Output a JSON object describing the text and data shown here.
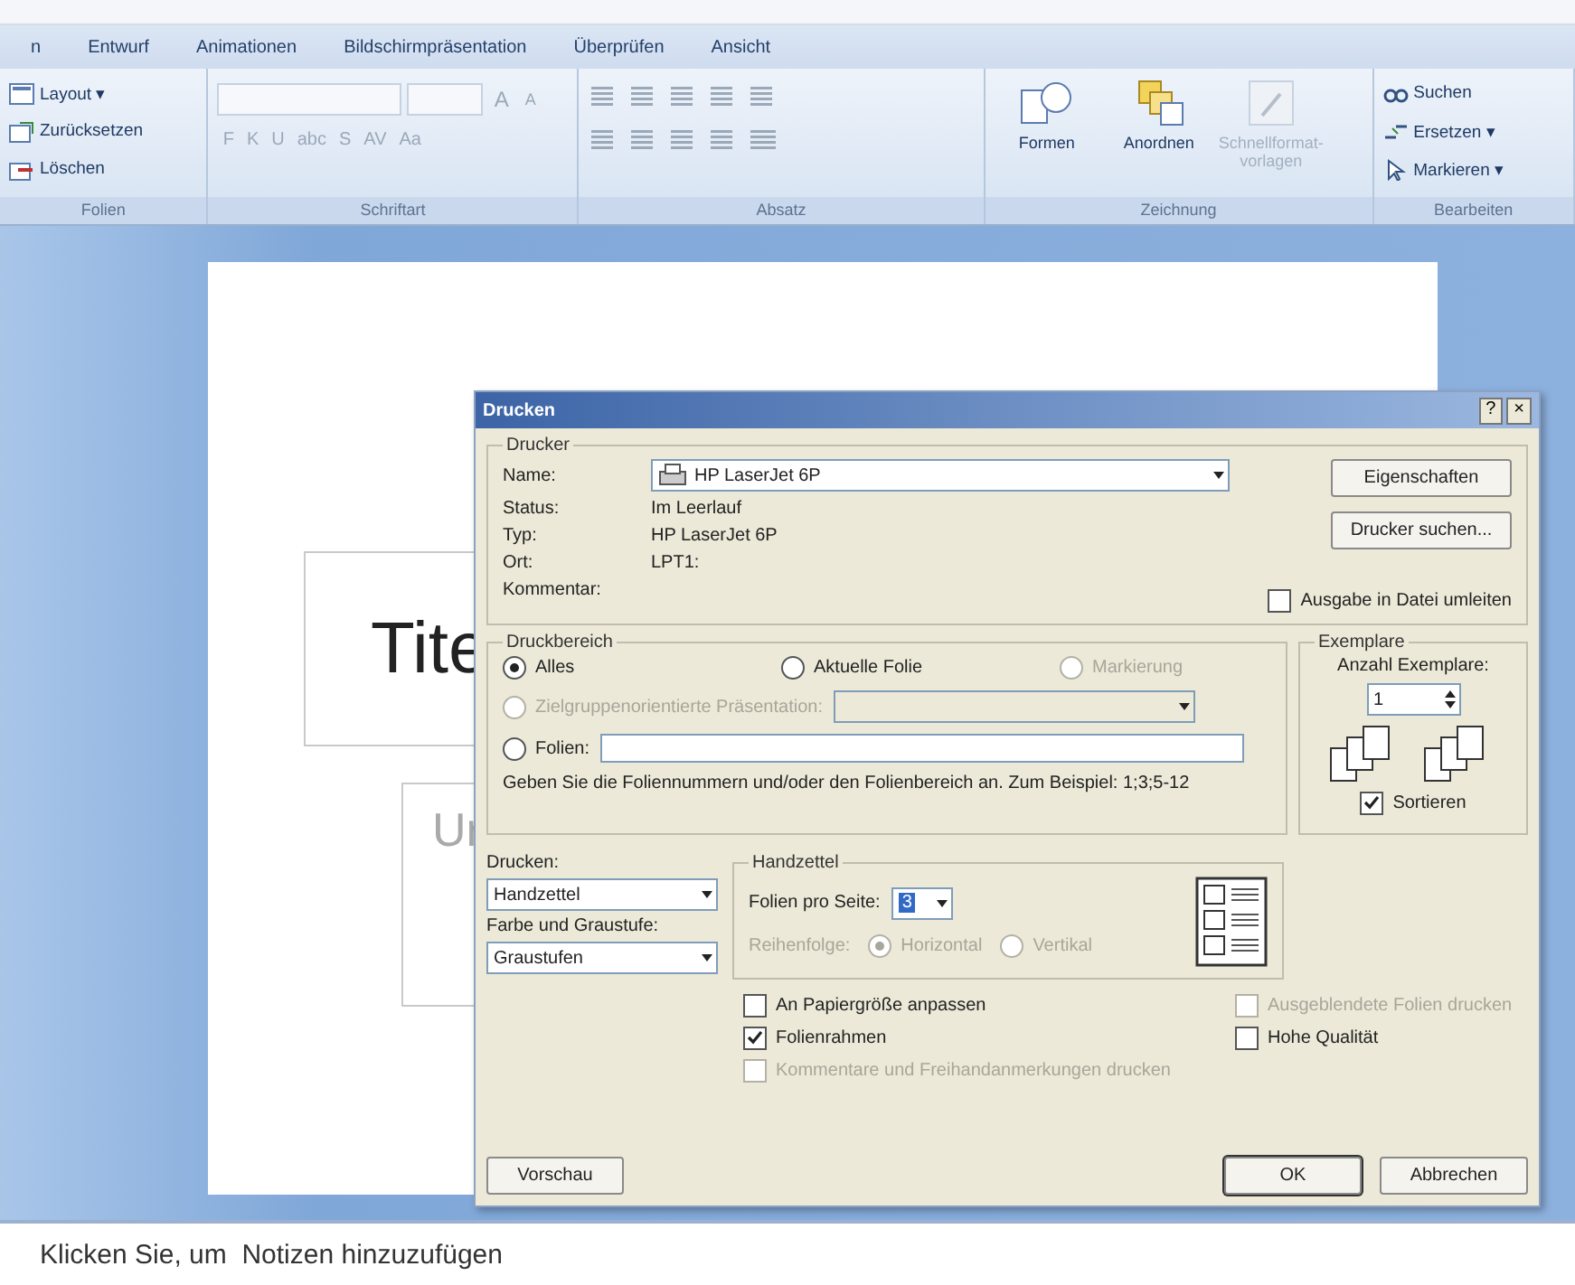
{
  "tabs": [
    {
      "label": "n",
      "selected": false
    },
    {
      "label": "Entwurf",
      "selected": false
    },
    {
      "label": "Animationen",
      "selected": false
    },
    {
      "label": "Bildschirmpräsentation",
      "selected": false
    },
    {
      "label": "Überprüfen",
      "selected": false
    },
    {
      "label": "Ansicht",
      "selected": false
    }
  ],
  "ribbon": {
    "folien": {
      "label": "Folien",
      "items": [
        {
          "label": "Layout ▾"
        },
        {
          "label": "Zurücksetzen"
        },
        {
          "label": "Löschen"
        }
      ]
    },
    "schriftart": {
      "label": "Schriftart",
      "disabled": true,
      "row1": [
        "A",
        "A"
      ],
      "row2": [
        "F",
        "K",
        "U",
        "abc",
        "S",
        "AV",
        "Aa"
      ]
    },
    "absatz": {
      "label": "Absatz"
    },
    "zeichnung": {
      "label": "Zeichnung",
      "items": [
        {
          "label": "Formen",
          "disabled": false
        },
        {
          "label": "Anordnen",
          "disabled": false
        },
        {
          "label": "Schnellformat- vorlagen",
          "disabled": true
        }
      ]
    },
    "bearbeiten": {
      "label": "Bearbeiten",
      "items": [
        {
          "label": "Suchen"
        },
        {
          "label": "Ersetzen ▾"
        },
        {
          "label": "Markieren ▾"
        }
      ]
    }
  },
  "slide": {
    "title": "Tite",
    "subtitle": "Ur"
  },
  "notes": {
    "placeholder": "Klicken Sie, um  Notizen hinzuzufügen"
  },
  "dialog": {
    "title": "Drucken",
    "help": "?",
    "close": "×",
    "printer": {
      "legend": "Drucker",
      "name_label": "Name:",
      "name": "HP LaserJet 6P",
      "info": [
        {
          "label": "Status:",
          "value": "Im Leerlauf"
        },
        {
          "label": "Typ:",
          "value": "HP LaserJet 6P"
        },
        {
          "label": "Ort:",
          "value": "LPT1:"
        },
        {
          "label": "Kommentar:"
        }
      ],
      "buttons": [
        "Eigenschaften",
        "Drucker suchen..."
      ],
      "to_file": {
        "label": "Ausgabe in Datei umleiten",
        "checked": false
      }
    },
    "range": {
      "legend": "Druckbereich",
      "options": [
        {
          "label": "Alles",
          "selected": true,
          "disabled": false
        },
        {
          "label": "Aktuelle Folie",
          "selected": false,
          "disabled": false
        },
        {
          "label": "Markierung",
          "selected": false,
          "disabled": true
        }
      ],
      "custom": {
        "label": "Zielgruppenorientierte Präsentation:",
        "selected": false,
        "disabled": true
      },
      "slides": {
        "label": "Folien:",
        "selected": false,
        "disabled": false
      },
      "hint": "Geben Sie die Foliennummern und/oder den Folienbereich an. Zum Beispiel: 1;3;5-12"
    },
    "copies": {
      "legend": "Exemplare",
      "label": "Anzahl Exemplare:",
      "value": "1",
      "collate": {
        "label": "Sortieren",
        "checked": true
      }
    },
    "print_what": {
      "label": "Drucken:",
      "value": "Handzettel"
    },
    "color": {
      "label": "Farbe und Graustufe:",
      "value": "Graustufen"
    },
    "handouts": {
      "legend": "Handzettel",
      "per_page_label": "Folien pro Seite:",
      "per_page": "3",
      "order_label": "Reihenfolge:",
      "disabled": true,
      "order": [
        {
          "label": "Horizontal",
          "selected": true
        },
        {
          "label": "Vertikal",
          "selected": false
        }
      ]
    },
    "options_left": [
      {
        "label": "An Papiergröße anpassen",
        "checked": false,
        "disabled": false
      },
      {
        "label": "Folienrahmen",
        "checked": true,
        "disabled": false
      },
      {
        "label": "Kommentare und Freihandanmerkungen drucken",
        "checked": false,
        "disabled": true
      }
    ],
    "options_right": [
      {
        "label": "Ausgeblendete Folien drucken",
        "checked": false,
        "disabled": true
      },
      {
        "label": "Hohe Qualität",
        "checked": false,
        "disabled": false
      }
    ],
    "preview": "Vorschau",
    "ok": "OK",
    "cancel": "Abbrechen"
  }
}
